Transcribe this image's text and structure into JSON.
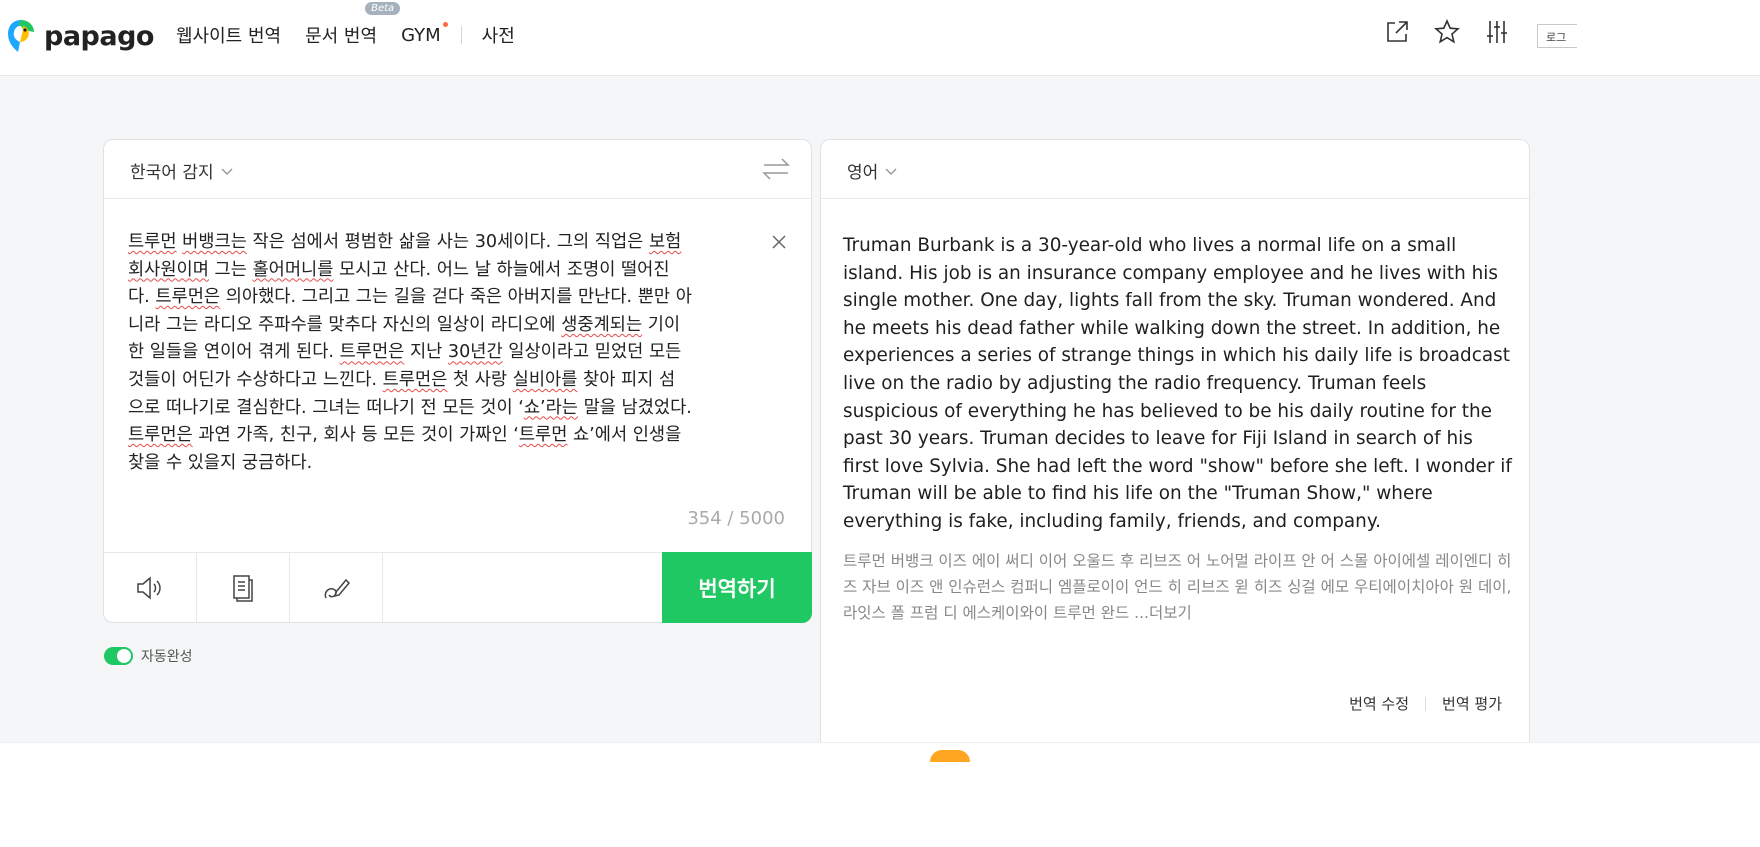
{
  "header": {
    "logo_text": "papago",
    "nav": [
      "웹사이트 번역",
      "문서 번역",
      "GYM",
      "사전"
    ],
    "beta_badge": "Beta",
    "login_label": "로그"
  },
  "source": {
    "language": "한국어 감지",
    "text_lines": [
      [
        {
          "t": "트루먼",
          "u": true
        },
        {
          "t": " "
        },
        {
          "t": "버뱅크는",
          "u": true
        },
        {
          "t": " 작은 섬에서 평범한 삶을 사는 30세이다. 그의 직업은 "
        },
        {
          "t": "보험",
          "u": true
        }
      ],
      [
        {
          "t": "회사원이며",
          "u": true
        },
        {
          "t": " 그는 "
        },
        {
          "t": "홀어머니를",
          "u": true
        },
        {
          "t": " 모시고 산다. 어느 날 하늘에서 조명이 떨어진"
        }
      ],
      [
        {
          "t": "다. "
        },
        {
          "t": "트루먼은",
          "u": true
        },
        {
          "t": " 의아했다. 그리고 그는 길을 걷다 죽은 아버지를 만난다. 뿐만 아"
        }
      ],
      [
        {
          "t": "니라 그는 라디오 주파수를 맞추다 자신의 일상이 라디오에 "
        },
        {
          "t": "생중계되는",
          "u": true
        },
        {
          "t": " 기이"
        }
      ],
      [
        {
          "t": "한 일들을 연이어 겪게 된다. "
        },
        {
          "t": "트루먼은",
          "u": true
        },
        {
          "t": " 지난 "
        },
        {
          "t": "30년간",
          "u": true
        },
        {
          "t": " 일상이라고 믿었던 모든"
        }
      ],
      [
        {
          "t": "것들이 어딘가 수상하다고 느낀다. "
        },
        {
          "t": "트루먼은",
          "u": true
        },
        {
          "t": " 첫 사랑 "
        },
        {
          "t": "실비아를",
          "u": true
        },
        {
          "t": " 찾아 피지 섬"
        }
      ],
      [
        {
          "t": "으로 떠나기로 결심한다. 그녀는 떠나기 전 모든 것이 ‘"
        },
        {
          "t": "쇼’라는",
          "u": true
        },
        {
          "t": " 말을 남겼었다."
        }
      ],
      [
        {
          "t": "트루먼은",
          "u": true
        },
        {
          "t": " 과연 가족, 친구, 회사 등 모든 것이 가짜인 ‘"
        },
        {
          "t": "트루먼",
          "u": true
        },
        {
          "t": " 쇼’에서 인생을"
        }
      ],
      [
        {
          "t": "찾을 수 있을지 궁금하다."
        }
      ]
    ],
    "char_count": "354 / 5000",
    "translate_button": "번역하기",
    "autocomplete_label": "자동완성",
    "autocomplete_on": true
  },
  "target": {
    "language": "영어",
    "text": "Truman Burbank is a 30-year-old who lives a normal life on a small island. His job is an insurance company employee and he lives with his single mother. One day, lights fall from the sky. Truman wondered. And he meets his dead father while walking down the street. In addition, he experiences a series of strange things in which his daily life is broadcast live on the radio by adjusting the radio frequency. Truman feels suspicious of everything he has believed to be his daily routine for the past 30 years. Truman decides to leave for Fiji Island in search of his first love Sylvia. She had left the word \"show\" before she left. I wonder if Truman will be able to find his life on the \"Truman Show,\" where everything is fake, including family, friends, and company.",
    "pronunciation": "트루먼 버뱅크 이즈 에이 써디 이어 오울드 후 리브즈 어 노어멀 라이프 안 어 스몰 아이에셀 레이엔디 히즈 자브 이즈 앤 인슈런스 컴퍼니 엠플로이이 언드 히 리브즈 윋 히즈 싱걸 에모 우티에이치아아 원 데이, 라잇스 폴 프럼 디 에스케이와이 트루먼 완드 ...",
    "more_label": "더보기",
    "edit_label": "번역 수정",
    "rate_label": "번역 평가"
  },
  "colors": {
    "accent_green": "#1fc862",
    "spell_underline": "#e54b4b"
  },
  "icons": [
    "share-icon",
    "star-icon",
    "settings-sliders-icon",
    "swap-icon",
    "close-icon",
    "speaker-icon",
    "document-icon",
    "handwriting-icon",
    "chevron-down-icon"
  ]
}
